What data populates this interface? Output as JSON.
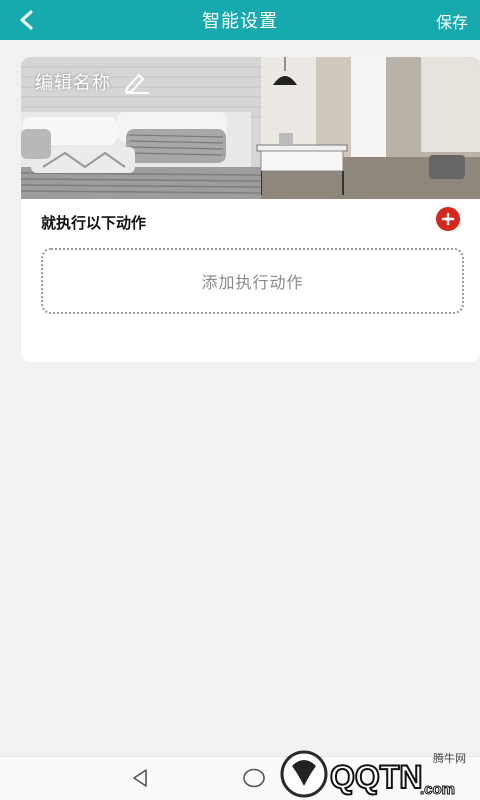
{
  "header": {
    "title": "智能设置",
    "save_label": "保存",
    "back_icon": "chevron-left-icon",
    "background_color": "#16a9ae"
  },
  "scene": {
    "name": "编辑名称",
    "edit_icon": "pencil-icon",
    "image": "bedroom-photo"
  },
  "actions": {
    "section_title": "就执行以下动作",
    "add_icon": "plus-circle-icon",
    "add_icon_color": "#d9261c",
    "add_placeholder": "添加执行动作"
  },
  "bottom_nav": {
    "back_icon": "triangle-back-icon",
    "home_icon": "circle-home-icon"
  },
  "watermark": {
    "site_label": "腾牛网",
    "logo_text": "QQTN.com"
  }
}
